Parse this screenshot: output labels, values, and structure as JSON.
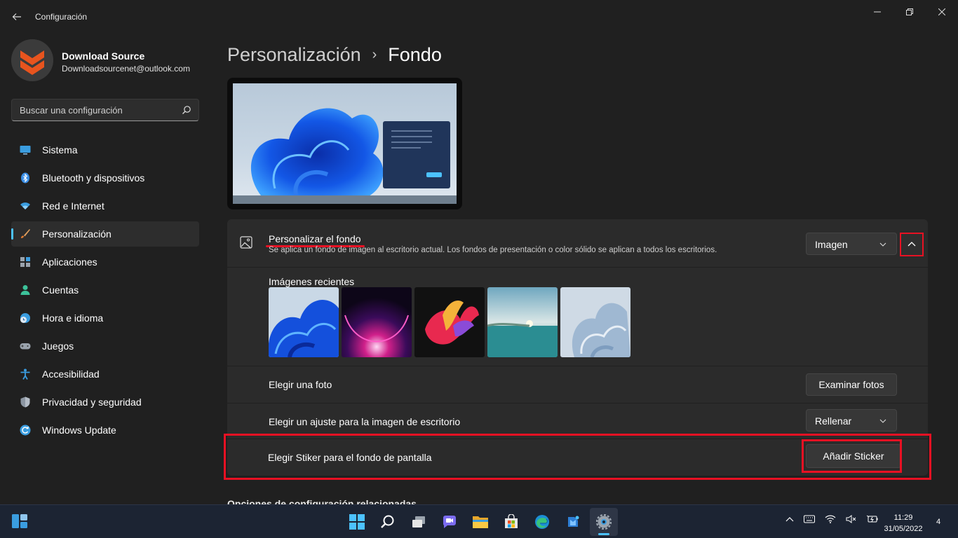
{
  "app": {
    "title": "Configuración"
  },
  "profile": {
    "name": "Download Source",
    "email": "Downloadsourcenet@outlook.com"
  },
  "search": {
    "placeholder": "Buscar una configuración"
  },
  "sidebar": {
    "items": [
      {
        "label": "Sistema",
        "icon": "monitor-icon"
      },
      {
        "label": "Bluetooth y dispositivos",
        "icon": "bluetooth-icon"
      },
      {
        "label": "Red e Internet",
        "icon": "wifi-icon"
      },
      {
        "label": "Personalización",
        "icon": "brush-icon",
        "active": true
      },
      {
        "label": "Aplicaciones",
        "icon": "apps-icon"
      },
      {
        "label": "Cuentas",
        "icon": "person-icon"
      },
      {
        "label": "Hora e idioma",
        "icon": "globe-clock-icon"
      },
      {
        "label": "Juegos",
        "icon": "gamepad-icon"
      },
      {
        "label": "Accesibilidad",
        "icon": "accessibility-icon"
      },
      {
        "label": "Privacidad y seguridad",
        "icon": "shield-icon"
      },
      {
        "label": "Windows Update",
        "icon": "update-icon"
      }
    ]
  },
  "breadcrumb": {
    "parent": "Personalización",
    "separator": "›",
    "current": "Fondo"
  },
  "background": {
    "title": "Personalizar el fondo",
    "description": "Se aplica un fondo de imagen al escritorio actual. Los fondos de presentación o color sólido se aplican a todos los escritorios.",
    "type_value": "Imagen",
    "recent_label": "Imágenes recientes",
    "choose_photo_label": "Elegir una foto",
    "browse_button": "Examinar fotos",
    "fit_label": "Elegir un ajuste para la imagen de escritorio",
    "fit_value": "Rellenar",
    "sticker_label": "Elegir Stiker para el fondo de pantalla",
    "sticker_button": "Añadir Sticker"
  },
  "related": {
    "title": "Opciones de configuración relacionadas"
  },
  "taskbar": {
    "time": "11:29",
    "date": "31/05/2022",
    "notifications": "4",
    "apps": [
      "windows-start-icon",
      "search-icon",
      "task-view-icon",
      "chat-icon",
      "file-explorer-icon",
      "store-icon",
      "edge-icon",
      "teams-app-icon",
      "settings-icon"
    ]
  },
  "colors": {
    "accent": "#4cc2ff",
    "highlight": "#e81123",
    "background": "#202020",
    "card": "#2b2b2b"
  }
}
